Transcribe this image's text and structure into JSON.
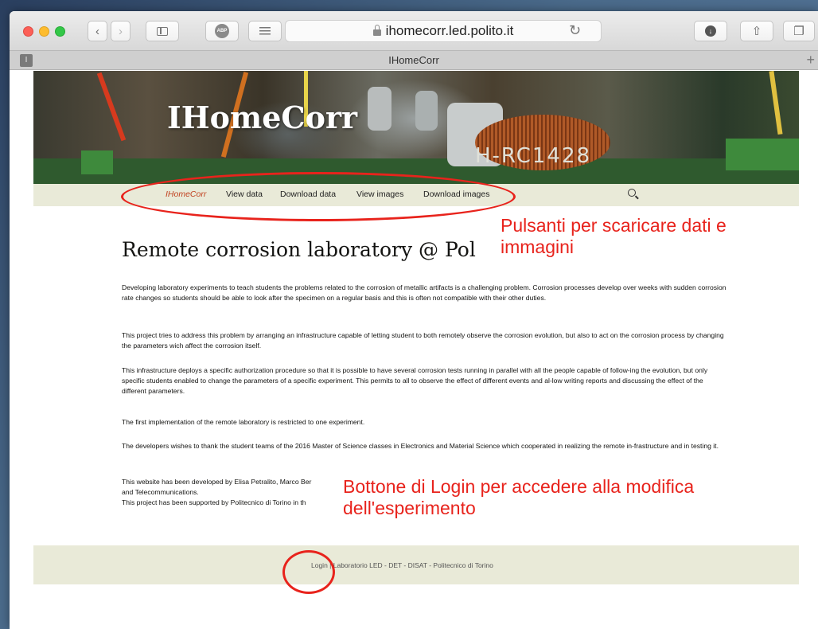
{
  "browser": {
    "url": "ihomecorr.led.polito.it",
    "tab_title": "IHomeCorr",
    "tab_icon_label": "I",
    "abp_label": "ABP"
  },
  "site": {
    "title": "IHomeCorr",
    "header_component_text": "H-RC1428",
    "nav": [
      "IHomeCorr",
      "View data",
      "Download data",
      "View images",
      "Download images"
    ],
    "heading": "Remote corrosion laboratory @ Pol",
    "paragraphs": [
      "Developing laboratory experiments to teach students the problems related to the corrosion of metallic artifacts is a challenging problem. Corrosion processes develop over weeks with sudden corrosion rate changes so students should be able to look after the specimen on a regular basis and this is often not compatible with their other duties.",
      "This project tries to address this problem by arranging an infrastructure capable of letting student to both remotely observe the corrosion evolution, but also to act on the corrosion process by changing the parameters wich affect the corrosion itself.",
      "This infrastructure deploys a specific authorization procedure so that it is possible to have several corrosion tests running in parallel with all the people capable of follow-ing the evolution, but only specific students enabled to change the parameters of a specific experiment. This permits to all to observe the effect of different events and al-low writing reports and discussing the effect of the different parameters.",
      "The first implementation of the remote laboratory is restricted to one experiment.",
      "The developers wishes to thank the student teams of the 2016 Master of Science classes in Electronics and Material Science which cooperated in realizing the remote in-frastructure and in testing it.",
      "This website has been developed by Elisa Petralito, Marco Ber",
      "and Telecommunications.",
      "This project has been supported by Politecnico di Torino in th"
    ],
    "footer": {
      "login": "Login",
      "separator": " | ",
      "rest": "Laboratorio LED - DET - DISAT - Politecnico di Torino"
    }
  },
  "annotations": {
    "nav_note": "Pulsanti per scaricare dati e immagini",
    "login_note": "Bottone di Login per accedere alla modifica dell'esperimento"
  },
  "colors": {
    "annotation": "#e8231c",
    "nav_active": "#c1411f",
    "nav_bg": "#e9ead8"
  }
}
